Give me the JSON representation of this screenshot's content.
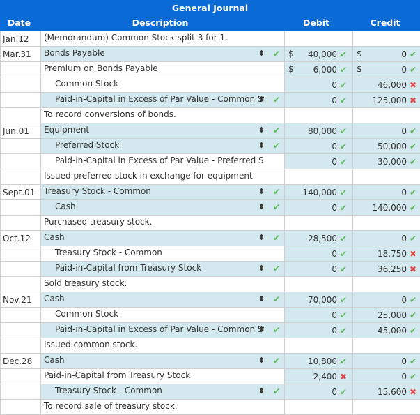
{
  "header": {
    "title": "General Journal",
    "columns": {
      "date": "Date",
      "description": "Description",
      "debit": "Debit",
      "credit": "Credit"
    }
  },
  "colors": {
    "header_bg": "#0a6ad6",
    "row_shade": "#d4e9ef",
    "correct": "#5cb85c",
    "incorrect": "#e04a4a"
  },
  "icons": {
    "sort": "⬍",
    "check": "✔",
    "cross": "✖"
  },
  "rows": [
    {
      "date": "Jan.12",
      "desc": "(Memorandum) Common Stock split 3 for 1.",
      "kind": "memo",
      "start": false
    },
    {
      "date": "Mar.31",
      "desc": "Bonds Payable",
      "indent": false,
      "select": true,
      "desc_mark": "check",
      "debit": "40,000",
      "debit_mark": "check",
      "credit": "0",
      "credit_mark": "check",
      "dollar": true,
      "shade": true,
      "start": true
    },
    {
      "date": "",
      "desc": "Premium on Bonds Payable",
      "indent": false,
      "select": false,
      "debit": "6,000",
      "debit_mark": "check",
      "credit": "0",
      "credit_mark": "check",
      "dollar": true,
      "shade": false
    },
    {
      "date": "",
      "desc": "Common Stock",
      "indent": true,
      "select": false,
      "debit": "0",
      "debit_mark": "check",
      "credit": "46,000",
      "credit_mark": "cross",
      "shade": false
    },
    {
      "date": "",
      "desc": "Paid-in-Capital in Excess of Par Value - Common Stock",
      "indent": true,
      "select": true,
      "desc_mark": "check",
      "debit": "0",
      "debit_mark": "check",
      "credit": "125,000",
      "credit_mark": "cross",
      "shade": true
    },
    {
      "date": "",
      "desc": "To record conversions of bonds.",
      "kind": "memo"
    },
    {
      "date": "Jun.01",
      "desc": "Equipment",
      "indent": false,
      "select": true,
      "desc_mark": "check",
      "debit": "80,000",
      "debit_mark": "check",
      "credit": "0",
      "credit_mark": "check",
      "shade": true,
      "start": true
    },
    {
      "date": "",
      "desc": "Preferred Stock",
      "indent": true,
      "select": true,
      "desc_mark": "check",
      "debit": "0",
      "debit_mark": "check",
      "credit": "50,000",
      "credit_mark": "check",
      "shade": true
    },
    {
      "date": "",
      "desc": "Paid-in-Capital in Excess of Par Value - Preferred Stock",
      "indent": true,
      "select": false,
      "debit": "0",
      "debit_mark": "check",
      "credit": "30,000",
      "credit_mark": "check",
      "shade": false
    },
    {
      "date": "",
      "desc": "Issued preferred stock in exchange for equipment.",
      "kind": "memo"
    },
    {
      "date": "Sept.01",
      "desc": "Treasury Stock - Common",
      "indent": false,
      "select": true,
      "desc_mark": "check",
      "debit": "140,000",
      "debit_mark": "check",
      "credit": "0",
      "credit_mark": "check",
      "shade": true,
      "start": true
    },
    {
      "date": "",
      "desc": "Cash",
      "indent": true,
      "select": true,
      "desc_mark": "check",
      "debit": "0",
      "debit_mark": "check",
      "credit": "140,000",
      "credit_mark": "check",
      "shade": true
    },
    {
      "date": "",
      "desc": "Purchased treasury stock.",
      "kind": "memo"
    },
    {
      "date": "Oct.12",
      "desc": "Cash",
      "indent": false,
      "select": true,
      "desc_mark": "check",
      "debit": "28,500",
      "debit_mark": "check",
      "credit": "0",
      "credit_mark": "check",
      "shade": true,
      "start": true
    },
    {
      "date": "",
      "desc": "Treasury Stock - Common",
      "indent": true,
      "select": false,
      "debit": "0",
      "debit_mark": "check",
      "credit": "18,750",
      "credit_mark": "cross",
      "shade": false
    },
    {
      "date": "",
      "desc": "Paid-in-Capital from Treasury Stock",
      "indent": true,
      "select": true,
      "desc_mark": "check",
      "debit": "0",
      "debit_mark": "check",
      "credit": "36,250",
      "credit_mark": "cross",
      "shade": true
    },
    {
      "date": "",
      "desc": "Sold treasury stock.",
      "kind": "memo"
    },
    {
      "date": "Nov.21",
      "desc": "Cash",
      "indent": false,
      "select": true,
      "desc_mark": "check",
      "debit": "70,000",
      "debit_mark": "check",
      "credit": "0",
      "credit_mark": "check",
      "shade": true,
      "start": true
    },
    {
      "date": "",
      "desc": "Common Stock",
      "indent": true,
      "select": false,
      "debit": "0",
      "debit_mark": "check",
      "credit": "25,000",
      "credit_mark": "check",
      "shade": false
    },
    {
      "date": "",
      "desc": "Paid-in-Capital in Excess of Par Value - Common Stock",
      "indent": true,
      "select": true,
      "desc_mark": "check",
      "debit": "0",
      "debit_mark": "check",
      "credit": "45,000",
      "credit_mark": "check",
      "shade": true
    },
    {
      "date": "",
      "desc": "Issued common stock.",
      "kind": "memo"
    },
    {
      "date": "Dec.28",
      "desc": "Cash",
      "indent": false,
      "select": true,
      "desc_mark": "check",
      "debit": "10,800",
      "debit_mark": "check",
      "credit": "0",
      "credit_mark": "check",
      "shade": true,
      "start": true
    },
    {
      "date": "",
      "desc": "Paid-in-Capital from Treasury Stock",
      "indent": false,
      "select": false,
      "debit": "2,400",
      "debit_mark": "cross",
      "credit": "0",
      "credit_mark": "check",
      "shade": false
    },
    {
      "date": "",
      "desc": "Treasury Stock - Common",
      "indent": true,
      "select": true,
      "desc_mark": "check",
      "debit": "0",
      "debit_mark": "check",
      "credit": "15,600",
      "credit_mark": "cross",
      "shade": true
    },
    {
      "date": "",
      "desc": "To record sale of treasury stock.",
      "kind": "memo"
    }
  ]
}
